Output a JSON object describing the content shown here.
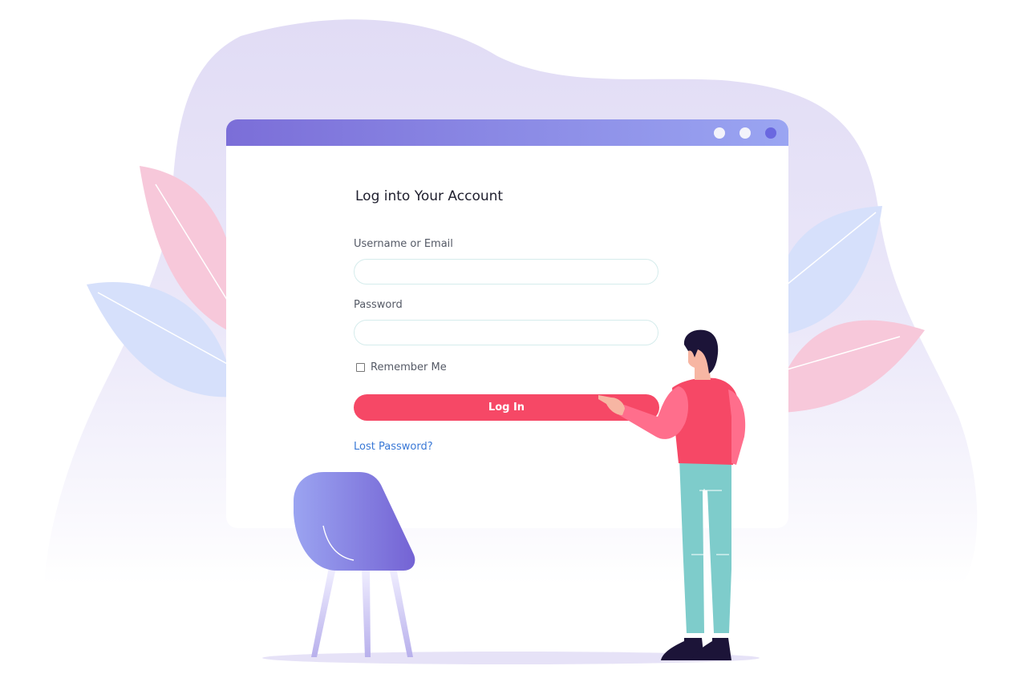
{
  "login": {
    "title": "Log into Your Account",
    "username_label": "Username or Email",
    "username_value": "",
    "password_label": "Password",
    "password_value": "",
    "remember_label": "Remember Me",
    "remember_checked": false,
    "submit_label": "Log In",
    "lost_password_label": "Lost Password?"
  },
  "window": {
    "controls": [
      "window-dot-1",
      "window-dot-2",
      "window-dot-3"
    ]
  },
  "illustration": {
    "elements": [
      "background-blob",
      "pink-leaf-left",
      "blue-leaf-left",
      "blue-leaf-right",
      "pink-leaf-right",
      "purple-chair",
      "man-pointing",
      "floor-shadow"
    ]
  },
  "colors": {
    "titlebar_start": "#7b6ed8",
    "titlebar_end": "#9aa5f2",
    "button": "#f64866",
    "link": "#3978d6",
    "blob": "#e4e1f6",
    "pink_leaf": "#f7c8da",
    "blue_leaf": "#d6e0fb",
    "chair": "#8a83e6",
    "shirt": "#f64866",
    "pants": "#7ecccb",
    "hair": "#1c1438"
  }
}
